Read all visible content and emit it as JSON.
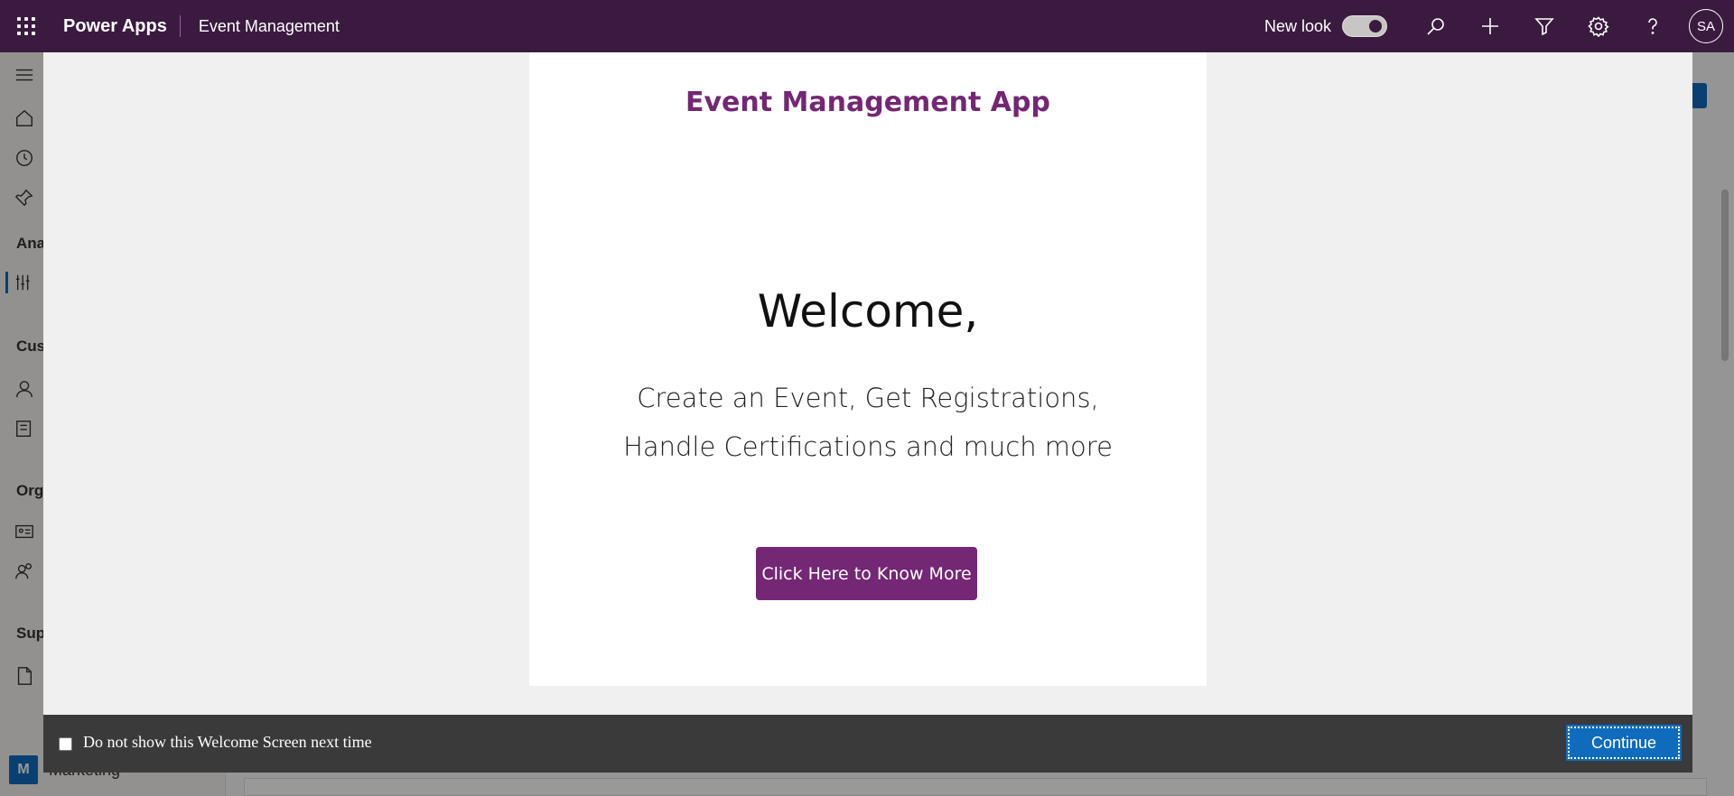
{
  "topbar": {
    "brand": "Power Apps",
    "app_name": "Event Management",
    "new_look_label": "New look",
    "avatar_initials": "SA",
    "background": "#3b1a40"
  },
  "sidebar": {
    "headings": [
      "Ana",
      "Cus",
      "Org",
      "Sup"
    ],
    "area": {
      "badge": "M",
      "label": "Marketing"
    }
  },
  "dialog": {
    "title": "Event Management App",
    "welcome": "Welcome,",
    "tagline": "Create an Event, Get Registrations, Handle Certifications and much more",
    "cta_label": "Click Here to Know More",
    "checkbox_label": "Do not show this Welcome Screen next time",
    "checkbox_checked": false,
    "continue_label": "Continue",
    "accent": "#742774",
    "button_color": "#0f6cbd"
  }
}
